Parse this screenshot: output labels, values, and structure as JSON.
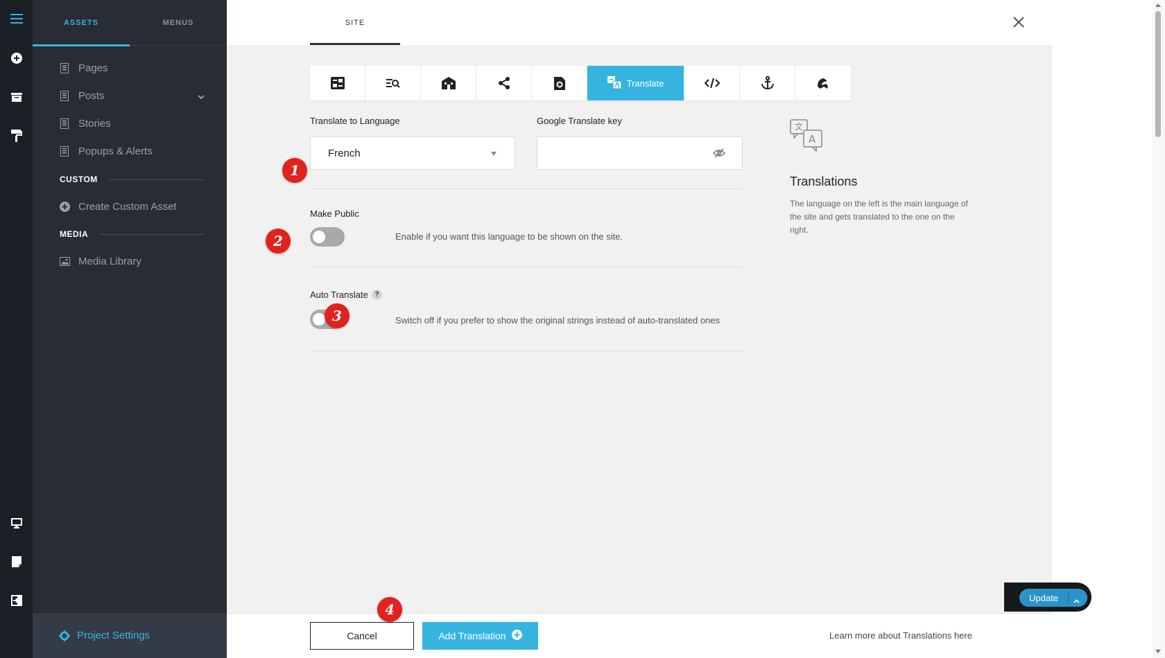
{
  "rail": {
    "icons": [
      "menu-icon",
      "add-icon",
      "archive-icon",
      "paint-roller-icon",
      "desktop-icon",
      "note-icon",
      "exit-icon"
    ]
  },
  "sidebar": {
    "tabs": [
      {
        "label": "ASSETS",
        "active": true
      },
      {
        "label": "MENUS",
        "active": false
      }
    ],
    "items": [
      {
        "label": "Pages",
        "icon": "page-icon"
      },
      {
        "label": "Posts",
        "icon": "page-icon"
      },
      {
        "label": "Stories",
        "icon": "page-icon"
      },
      {
        "label": "Popups & Alerts",
        "icon": "page-icon"
      }
    ],
    "custom_heading": "CUSTOM",
    "create_custom": "Create Custom Asset",
    "media_heading": "MEDIA",
    "media_library": "Media Library",
    "project_settings": "Project Settings"
  },
  "main": {
    "site_tab": "SITE",
    "toolbar": {
      "icons": [
        "general-settings-icon",
        "seo-icon",
        "company-icon",
        "share-icon",
        "file-settings-icon",
        "translate-icon",
        "code-icon",
        "anchor-icon",
        "dragon-icon"
      ],
      "active_label": "Translate"
    },
    "form": {
      "language_label": "Translate to Language",
      "language_value": "French",
      "key_label": "Google Translate key",
      "key_value": "",
      "make_public_label": "Make Public",
      "make_public_desc": "Enable if you want this language to be shown on the site.",
      "make_public_on": false,
      "auto_translate_label": "Auto Translate",
      "auto_translate_help": "?",
      "auto_translate_desc": "Switch off if you prefer to show the original strings instead of auto-translated ones",
      "auto_translate_on": false
    },
    "info": {
      "title": "Translations",
      "text": "The language on the left is the main language of the site and gets translated to the one on the right."
    },
    "footer": {
      "cancel": "Cancel",
      "add": "Add Translation",
      "learn_more": "Learn more about Translations here"
    }
  },
  "callouts": [
    "1",
    "2",
    "3",
    "4"
  ],
  "update": {
    "label": "Update"
  },
  "colors": {
    "accent": "#36b4e0",
    "rail_bg": "#1b1f26",
    "sidebar_bg": "#272c35",
    "callout": "#e0231c"
  }
}
